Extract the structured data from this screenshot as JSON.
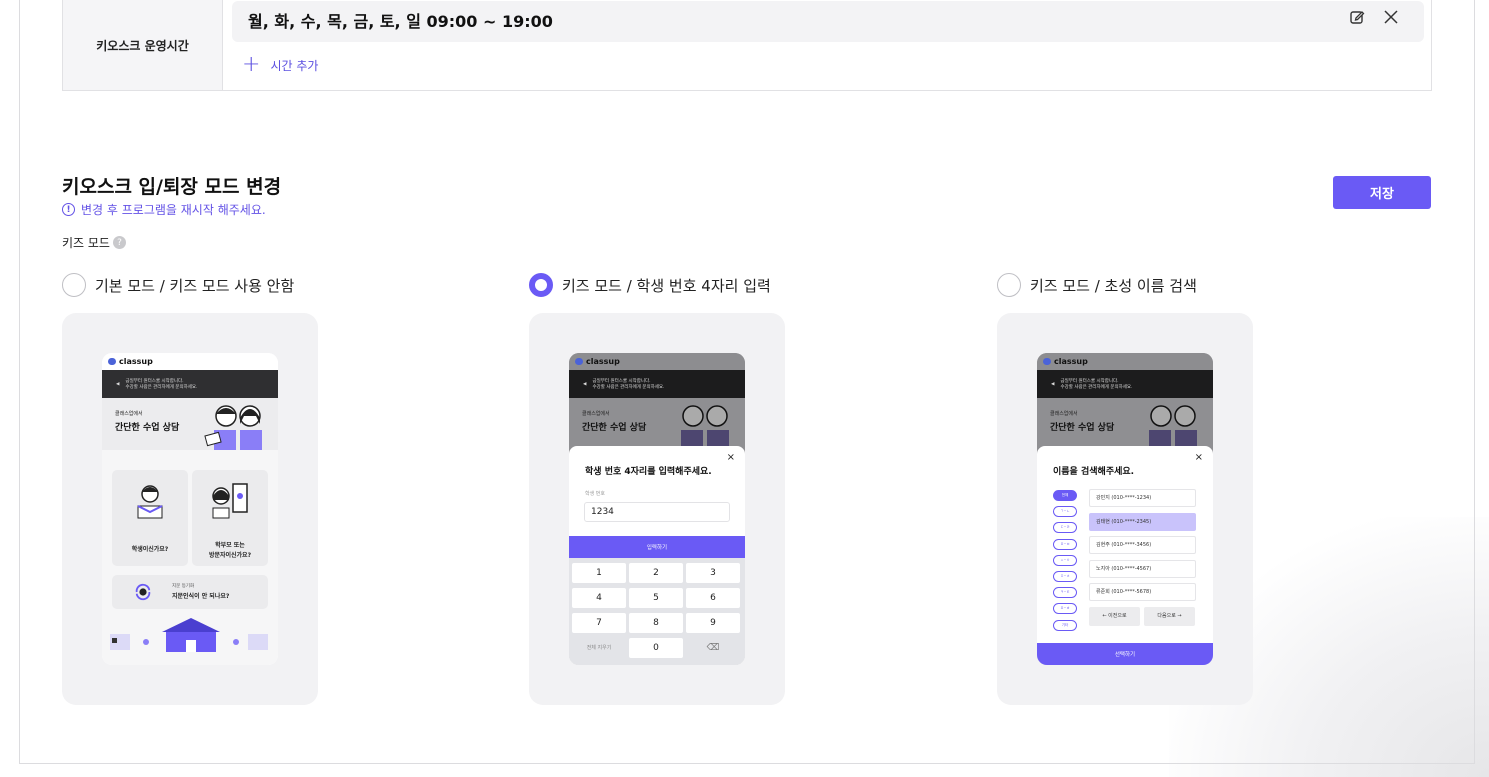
{
  "hours": {
    "label": "키오스크 운영시간",
    "schedule": "월, 화, 수, 목, 금, 토, 일 09:00 ~ 19:00",
    "add_label": "시간 추가"
  },
  "mode_section": {
    "title": "키오스크 입/퇴장 모드 변경",
    "notice": "변경 후 프로그램을 재시작 해주세요.",
    "save_label": "저장",
    "kids_label": "키즈 모드",
    "help_glyph": "?",
    "options": [
      {
        "label": "기본 모드 / 키즈 모드 사용 안함",
        "selected": false
      },
      {
        "label": "키즈 모드 / 학생 번호 4자리 입력",
        "selected": true
      },
      {
        "label": "키즈 모드 / 초성 이름 검색",
        "selected": false
      }
    ]
  },
  "preview": {
    "brand": "classup",
    "banner_line1": "금일부터 원터스쿨 시작합니다.",
    "banner_line2": "수강할 사람은 관리자에게 문의하세요.",
    "hero_small": "클래스업에서",
    "hero_big": "간단한 수업 상담",
    "tile_student": "학생이신가요?",
    "tile_parent_1": "학부모 또는",
    "tile_parent_2": "방문자이신가요?",
    "tile_face_small": "지문 등기화",
    "tile_face_big": "지문인식이 안 되나요?",
    "number_title": "학생 번호 4자리를 입력해주세요.",
    "number_field_label": "학생 번호",
    "number_value": "1234",
    "number_submit": "입력하기",
    "keys": [
      "1",
      "2",
      "3",
      "4",
      "5",
      "6",
      "7",
      "8",
      "9",
      "전체 지우기",
      "0",
      "⌫"
    ],
    "search_title": "이름을 검색해주세요.",
    "chips": [
      "전체",
      "ㄱ~ㄴ",
      "ㄷ~ㄹ",
      "ㅁ~ㅂ",
      "ㅅ~ㅇ",
      "ㅈ~ㅊ",
      "ㅋ~ㅌ",
      "ㅍ~ㅎ",
      "기타"
    ],
    "names": [
      "강민지 (010-****-1234)",
      "김태현 (010-****-2345)",
      "김현주 (010-****-3456)",
      "노지아 (010-****-4567)",
      "류준희 (010-****-5678)"
    ],
    "prev_label": "← 이전으로",
    "next_label": "다음으로 →",
    "select_label": "선택하기",
    "close_glyph": "×"
  },
  "colors": {
    "accent": "#6a5af5",
    "accent_text": "#5b4fe0"
  }
}
